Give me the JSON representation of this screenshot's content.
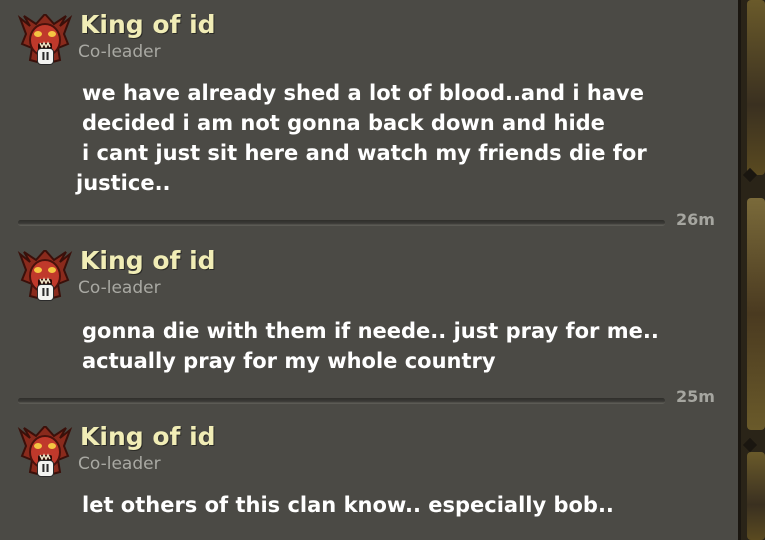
{
  "chat": {
    "messages": [
      {
        "sender": "King of id",
        "role": "Co-leader",
        "badge": "II",
        "lines": [
          "we have already shed a lot of blood..and i have",
          "decided i am not gonna back down and hide",
          "i cant just sit here and watch my friends die for",
          "justice.."
        ],
        "time": "26m"
      },
      {
        "sender": "King of id",
        "role": "Co-leader",
        "badge": "II",
        "lines": [
          "gonna die with them if neede.. just pray for me..",
          "actually pray for my whole country"
        ],
        "time": "25m"
      },
      {
        "sender": "King of id",
        "role": "Co-leader",
        "badge": "II",
        "lines": [
          "let others of this clan know.. especially bob.."
        ],
        "time": ""
      }
    ]
  },
  "colors": {
    "background": "#4b4a45",
    "name": "#f1edb6",
    "role": "#a9a9a3",
    "body": "#ffffff",
    "time": "#a6a6a0"
  },
  "icons": {
    "avatar": "clan-league-badge-icon",
    "rank_badge": "pause-badge-icon"
  }
}
